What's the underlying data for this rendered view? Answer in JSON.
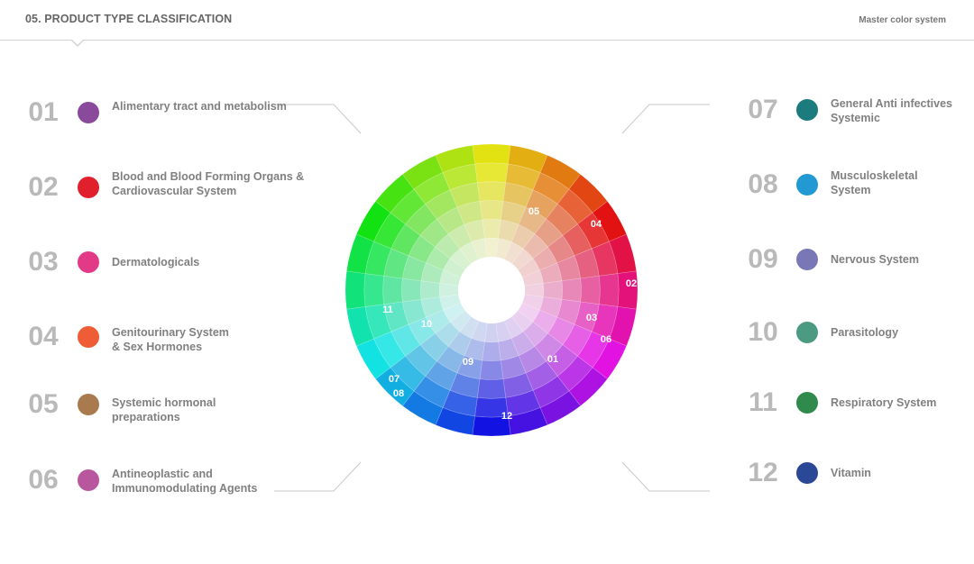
{
  "header": {
    "title": "05. PRODUCT TYPE CLASSIFICATION",
    "subtitle": "Master color system"
  },
  "categories": [
    {
      "num": "01",
      "label": "Alimentary tract and metabolism",
      "color": "#8a4a9c"
    },
    {
      "num": "02",
      "label": "Blood and Blood Forming Organs & Cardiovascular System",
      "color": "#e0202a"
    },
    {
      "num": "03",
      "label": "Dermatologicals",
      "color": "#e23a87"
    },
    {
      "num": "04",
      "label": "Genitourinary System & Sex Hormones",
      "color": "#ee5d35"
    },
    {
      "num": "05",
      "label": "Systemic hormonal preparations",
      "color": "#a97a4e"
    },
    {
      "num": "06",
      "label": "Antineoplastic and Immunomodulating Agents",
      "color": "#b9579e"
    },
    {
      "num": "07",
      "label": "General Anti infectives Systemic",
      "color": "#1c7b7c"
    },
    {
      "num": "08",
      "label": "Musculoskeletal System",
      "color": "#2399d3"
    },
    {
      "num": "09",
      "label": "Nervous System",
      "color": "#7a77b7"
    },
    {
      "num": "10",
      "label": "Parasitology",
      "color": "#4c9a81"
    },
    {
      "num": "11",
      "label": "Respiratory System",
      "color": "#2f8a4b"
    },
    {
      "num": "12",
      "label": "Vitamin",
      "color": "#2b4897"
    }
  ],
  "wheel": {
    "labels": [
      "05",
      "04",
      "02",
      "03",
      "06",
      "01",
      "12",
      "09",
      "08",
      "07",
      "10",
      "11"
    ]
  }
}
